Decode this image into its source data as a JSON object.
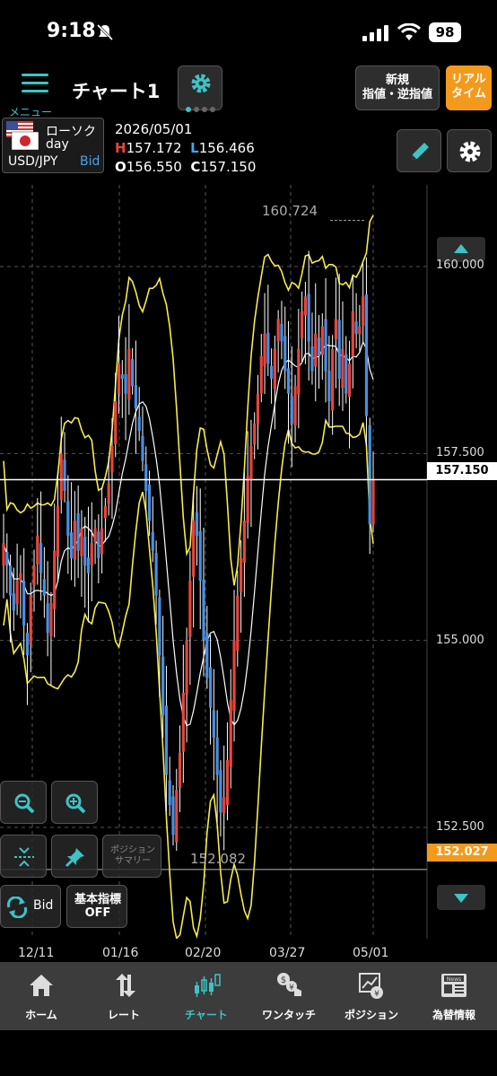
{
  "status": {
    "time": "9:18",
    "battery": "98"
  },
  "header": {
    "menu_label": "メニュー",
    "title": "チャート1",
    "order_button": [
      "新規",
      "指値・逆指値"
    ],
    "realtime_button": [
      "リアル",
      "タイム"
    ]
  },
  "instrument": {
    "type": "ローソク",
    "period": "day",
    "pair": "USD/JPY",
    "side": "Bid",
    "date": "2026/05/01",
    "high_label": "H",
    "high": "157.172",
    "low_label": "L",
    "low": "156.466",
    "open_label": "O",
    "open": "156.550",
    "close_label": "C",
    "close": "157.150"
  },
  "chart": {
    "max_label": "160.724",
    "min_label": "152.082",
    "price_labels": [
      "160.000",
      "157.500",
      "155.000",
      "152.500"
    ],
    "current_price": "157.150",
    "lowest_price_tag": "152.027",
    "date_labels": [
      "12/11",
      "01/16",
      "02/20",
      "03/27",
      "05/01"
    ],
    "colors": {
      "up": "#e8453c",
      "down": "#4a8fe0",
      "band": "#f5ec4c",
      "ma": "#ffffff",
      "accent": "#3ec3c5",
      "orange": "#f39a1c"
    }
  },
  "chart_data": {
    "type": "candlestick",
    "ylim": [
      151.0,
      161.6
    ],
    "y_ticks": [
      160.0,
      157.5,
      155.0,
      152.5
    ],
    "x_ticks": [
      "12/11",
      "01/16",
      "02/20",
      "03/27",
      "05/01"
    ],
    "last": {
      "date": "2026/05/01",
      "open": 156.55,
      "high": 157.172,
      "low": 156.466,
      "close": 157.15
    },
    "max_marker": 160.724,
    "min_marker": 152.082,
    "closes": [
      156.3,
      156.0,
      155.6,
      155.4,
      155.8,
      155.9,
      155.2,
      154.8,
      155.6,
      156.0,
      156.4,
      155.9,
      155.6,
      155.1,
      155.5,
      156.2,
      156.8,
      157.5,
      157.0,
      156.4,
      156.1,
      156.6,
      156.2,
      156.5,
      156.0,
      155.9,
      156.3,
      156.5,
      156.1,
      156.5,
      156.8,
      157.1,
      157.6,
      158.2,
      158.7,
      158.5,
      158.3,
      158.9,
      158.4,
      158.1,
      157.8,
      157.4,
      157.0,
      156.6,
      156.2,
      155.6,
      154.8,
      154.0,
      153.2,
      152.8,
      152.4,
      153.0,
      153.5,
      154.3,
      155.0,
      155.8,
      156.6,
      156.4,
      155.8,
      155.0,
      154.5,
      154.1,
      153.7,
      153.2,
      152.7,
      152.9,
      153.4,
      154.2,
      155.0,
      155.6,
      156.1,
      156.6,
      157.2,
      157.6,
      157.9,
      158.3,
      158.8,
      159.1,
      158.7,
      158.5,
      158.9,
      159.3,
      159.0,
      158.6,
      158.3,
      157.9,
      158.4,
      158.9,
      159.4,
      159.6,
      159.0,
      158.6,
      159.1,
      158.8,
      159.2,
      158.6,
      158.2,
      158.9,
      159.3,
      158.5,
      158.9,
      158.3,
      158.7,
      159.4,
      159.1,
      159.2,
      159.6,
      158.0,
      156.55,
      157.15
    ],
    "bollinger_upper_label": "",
    "moving_average_label": ""
  },
  "overlay": {
    "position_summary": "ポジション サマリー",
    "bid_label": "Bid",
    "indicator_label": [
      "基本指標",
      "OFF"
    ]
  },
  "tabs": [
    {
      "label": "ホーム",
      "icon": "home-icon"
    },
    {
      "label": "レート",
      "icon": "rate-icon"
    },
    {
      "label": "チャート",
      "icon": "chart-icon",
      "active": true
    },
    {
      "label": "ワンタッチ",
      "icon": "one-touch-icon"
    },
    {
      "label": "ポジション",
      "icon": "position-icon"
    },
    {
      "label": "為替情報",
      "icon": "news-icon"
    }
  ]
}
